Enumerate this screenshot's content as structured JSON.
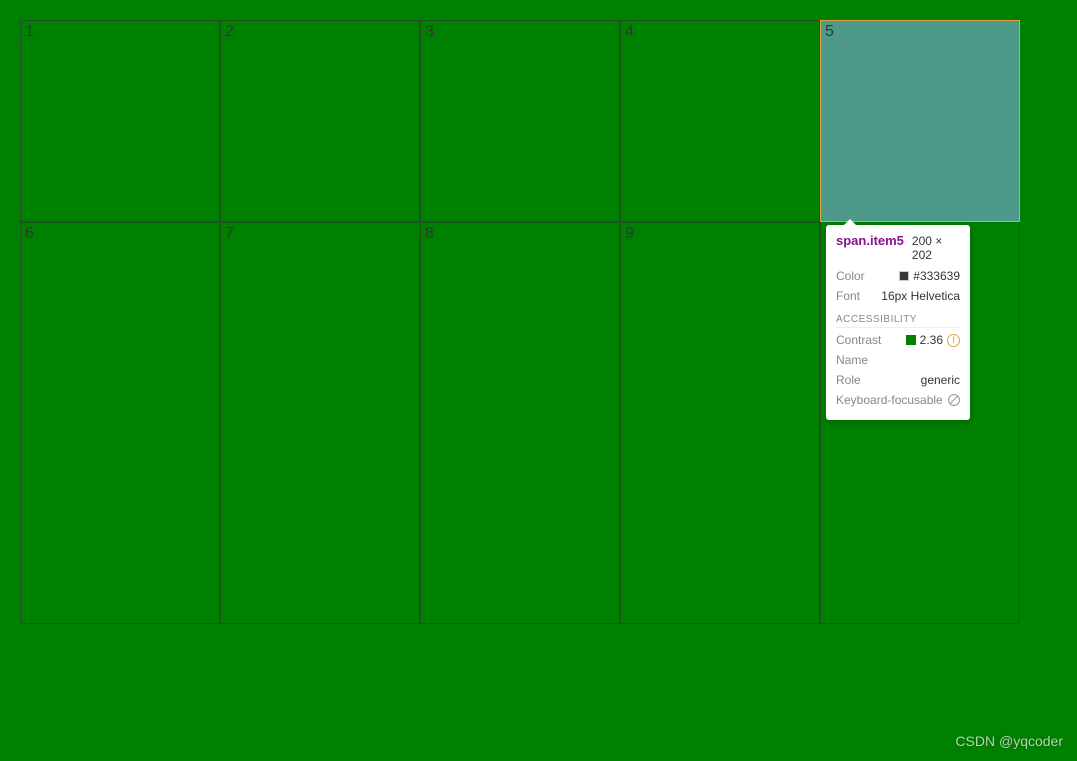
{
  "grid": {
    "row1": [
      "1",
      "2",
      "3",
      "4",
      "5"
    ],
    "row2": [
      "6",
      "7",
      "8",
      "9",
      ""
    ]
  },
  "tooltip": {
    "selector": "span.item5",
    "dimensions": "200 × 202",
    "color_label": "Color",
    "color_value": "#333639",
    "font_label": "Font",
    "font_value": "16px Helvetica",
    "accessibility_heading": "ACCESSIBILITY",
    "contrast_label": "Contrast",
    "contrast_value": "2.36",
    "name_label": "Name",
    "name_value": "",
    "role_label": "Role",
    "role_value": "generic",
    "kf_label": "Keyboard-focusable"
  },
  "watermark": "CSDN @yqcoder"
}
